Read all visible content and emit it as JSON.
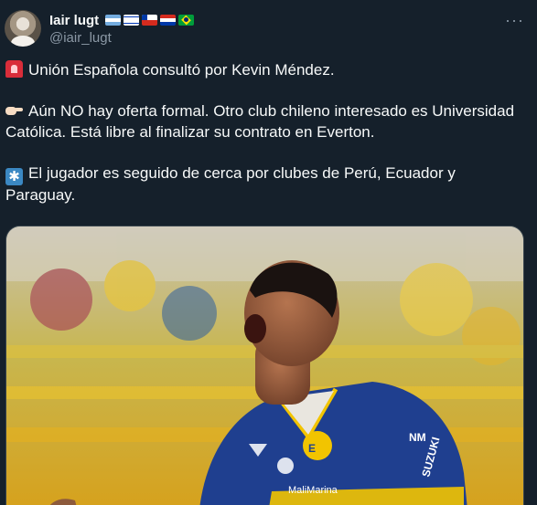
{
  "author": {
    "display_name": "Iair lugt",
    "handle": "@iair_lugt",
    "flags": [
      "argentina-flag",
      "israel-flag",
      "chile-flag",
      "paraguay-flag",
      "brazil-flag"
    ]
  },
  "menu": {
    "more_label": "···"
  },
  "tweet": {
    "paragraphs": [
      {
        "icon": "rotating-light-emoji",
        "text": "Unión Española consultó por Kevin Méndez."
      },
      {
        "icon": "pointing-hand-emoji",
        "text": "Aún NO hay oferta formal. Otro club chileno interesado es Universidad Católica. Está libre al finalizar su contrato en Everton."
      },
      {
        "icon": "asterisk-emoji",
        "text": "El jugador es seguido de cerca por clubes de Perú, Ecuador y Paraguay."
      }
    ],
    "asterisk_glyph": "✱"
  },
  "media": {
    "description_icon": "football-player-photo",
    "jersey_texts": [
      "MaliMarina",
      "NM",
      "SUZUKI"
    ],
    "colors": {
      "jersey": "#1f3f8f",
      "jersey_trim": "#f2c400",
      "background": "#15202b"
    }
  }
}
